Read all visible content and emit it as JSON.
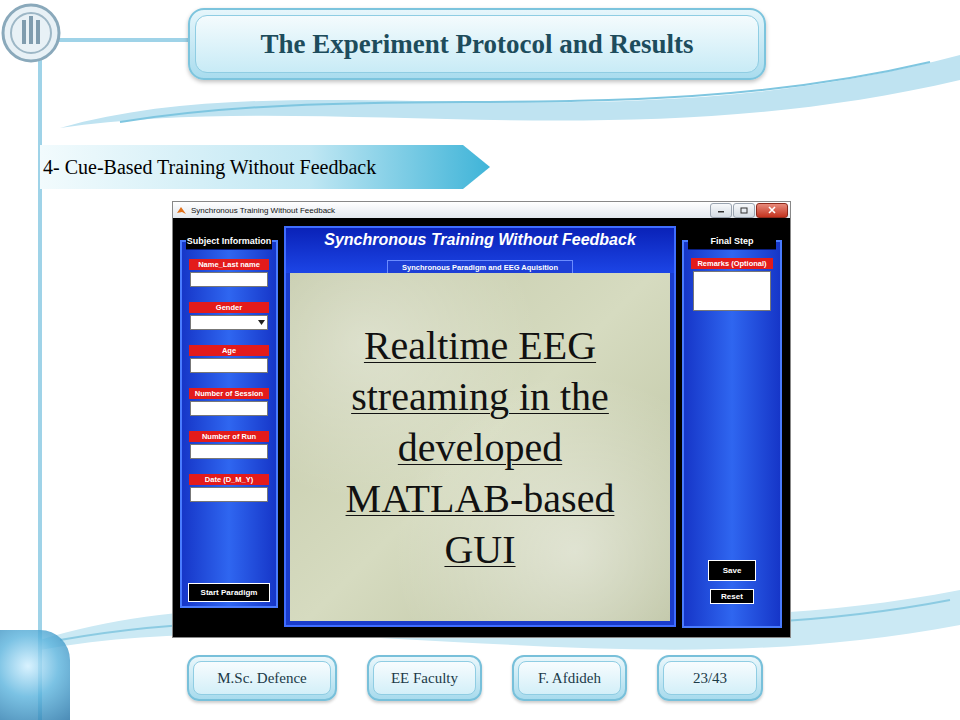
{
  "slide": {
    "title": "The Experiment Protocol and Results",
    "section": "4- Cue-Based Training Without Feedback"
  },
  "window": {
    "title": "Synchronous Training Without Feedback"
  },
  "app": {
    "header": "Synchronous Training Without Feedback",
    "subheader": "Synchronous Paradigm and EEG Aquisition",
    "caption": "Realtime EEG streaming in the developed MATLAB-based GUI"
  },
  "subject_panel": {
    "title": "Subject Information",
    "fields": [
      {
        "label": "Name_Last name",
        "kind": "text",
        "value": ""
      },
      {
        "label": "Gender",
        "kind": "select",
        "value": ""
      },
      {
        "label": "Age",
        "kind": "text",
        "value": ""
      },
      {
        "label": "Number of Session",
        "kind": "text",
        "value": ""
      },
      {
        "label": "Number of Run",
        "kind": "text",
        "value": ""
      },
      {
        "label": "Date (D_M_Y)",
        "kind": "text",
        "value": ""
      }
    ],
    "button": "Start Paradigm"
  },
  "final_panel": {
    "title": "Final Step",
    "remarks_label": "Remarks (Optional)",
    "remarks_value": "",
    "buttons": [
      "Save",
      "Reset"
    ]
  },
  "footer": [
    "M.Sc. Defence",
    "EE Faculty",
    "F. Afdideh",
    "23/43"
  ]
}
